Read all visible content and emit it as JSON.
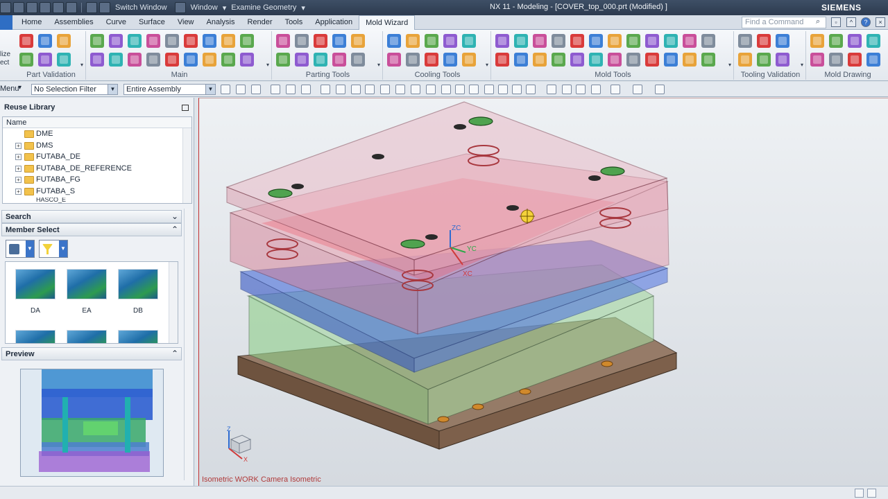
{
  "titlebar": {
    "switch_window": "Switch Window",
    "window_menu": "Window",
    "examine_geometry": "Examine Geometry",
    "title": "NX 11 - Modeling - [COVER_top_000.prt (Modified) ]",
    "brand": "SIEMENS"
  },
  "tabs": [
    "Home",
    "Assemblies",
    "Curve",
    "Surface",
    "View",
    "Analysis",
    "Render",
    "Tools",
    "Application",
    "Mold Wizard"
  ],
  "active_tab": "Mold Wizard",
  "command_search": {
    "placeholder": "Find a Command"
  },
  "ribbon": {
    "left_cut_labels": [
      "lize",
      "ect"
    ],
    "groups": [
      {
        "label": "Part Validation"
      },
      {
        "label": "Main"
      },
      {
        "label": "Parting Tools"
      },
      {
        "label": "Cooling Tools"
      },
      {
        "label": "Mold Tools"
      },
      {
        "label": "Tooling Validation"
      },
      {
        "label": "Mold Drawing"
      }
    ]
  },
  "selection_bar": {
    "menu_label": "Menu",
    "filter_value": "No Selection Filter",
    "scope_value": "Entire Assembly"
  },
  "reuse_library": {
    "title": "Reuse Library",
    "column_header": "Name",
    "tree_items": [
      "DME",
      "DMS",
      "FUTABA_DE",
      "FUTABA_DE_REFERENCE",
      "FUTABA_FG",
      "FUTABA_S",
      "HASCO_E"
    ]
  },
  "search": {
    "title": "Search"
  },
  "member_select": {
    "title": "Member Select",
    "items": [
      "DA",
      "EA",
      "DB"
    ]
  },
  "preview": {
    "title": "Preview"
  },
  "viewport": {
    "view_label": "Isometric WORK Camera Isometric",
    "axis_labels": {
      "zc": "ZC",
      "yc": "YC",
      "xc": "XC",
      "z": "Z",
      "x": "X"
    }
  },
  "colors": {
    "accent": "#2f6ec4",
    "plate_pink": "#e25a78",
    "plate_blue": "#3a62d8",
    "plate_green": "#8fcf8a",
    "base_brown": "#8a6a52"
  }
}
